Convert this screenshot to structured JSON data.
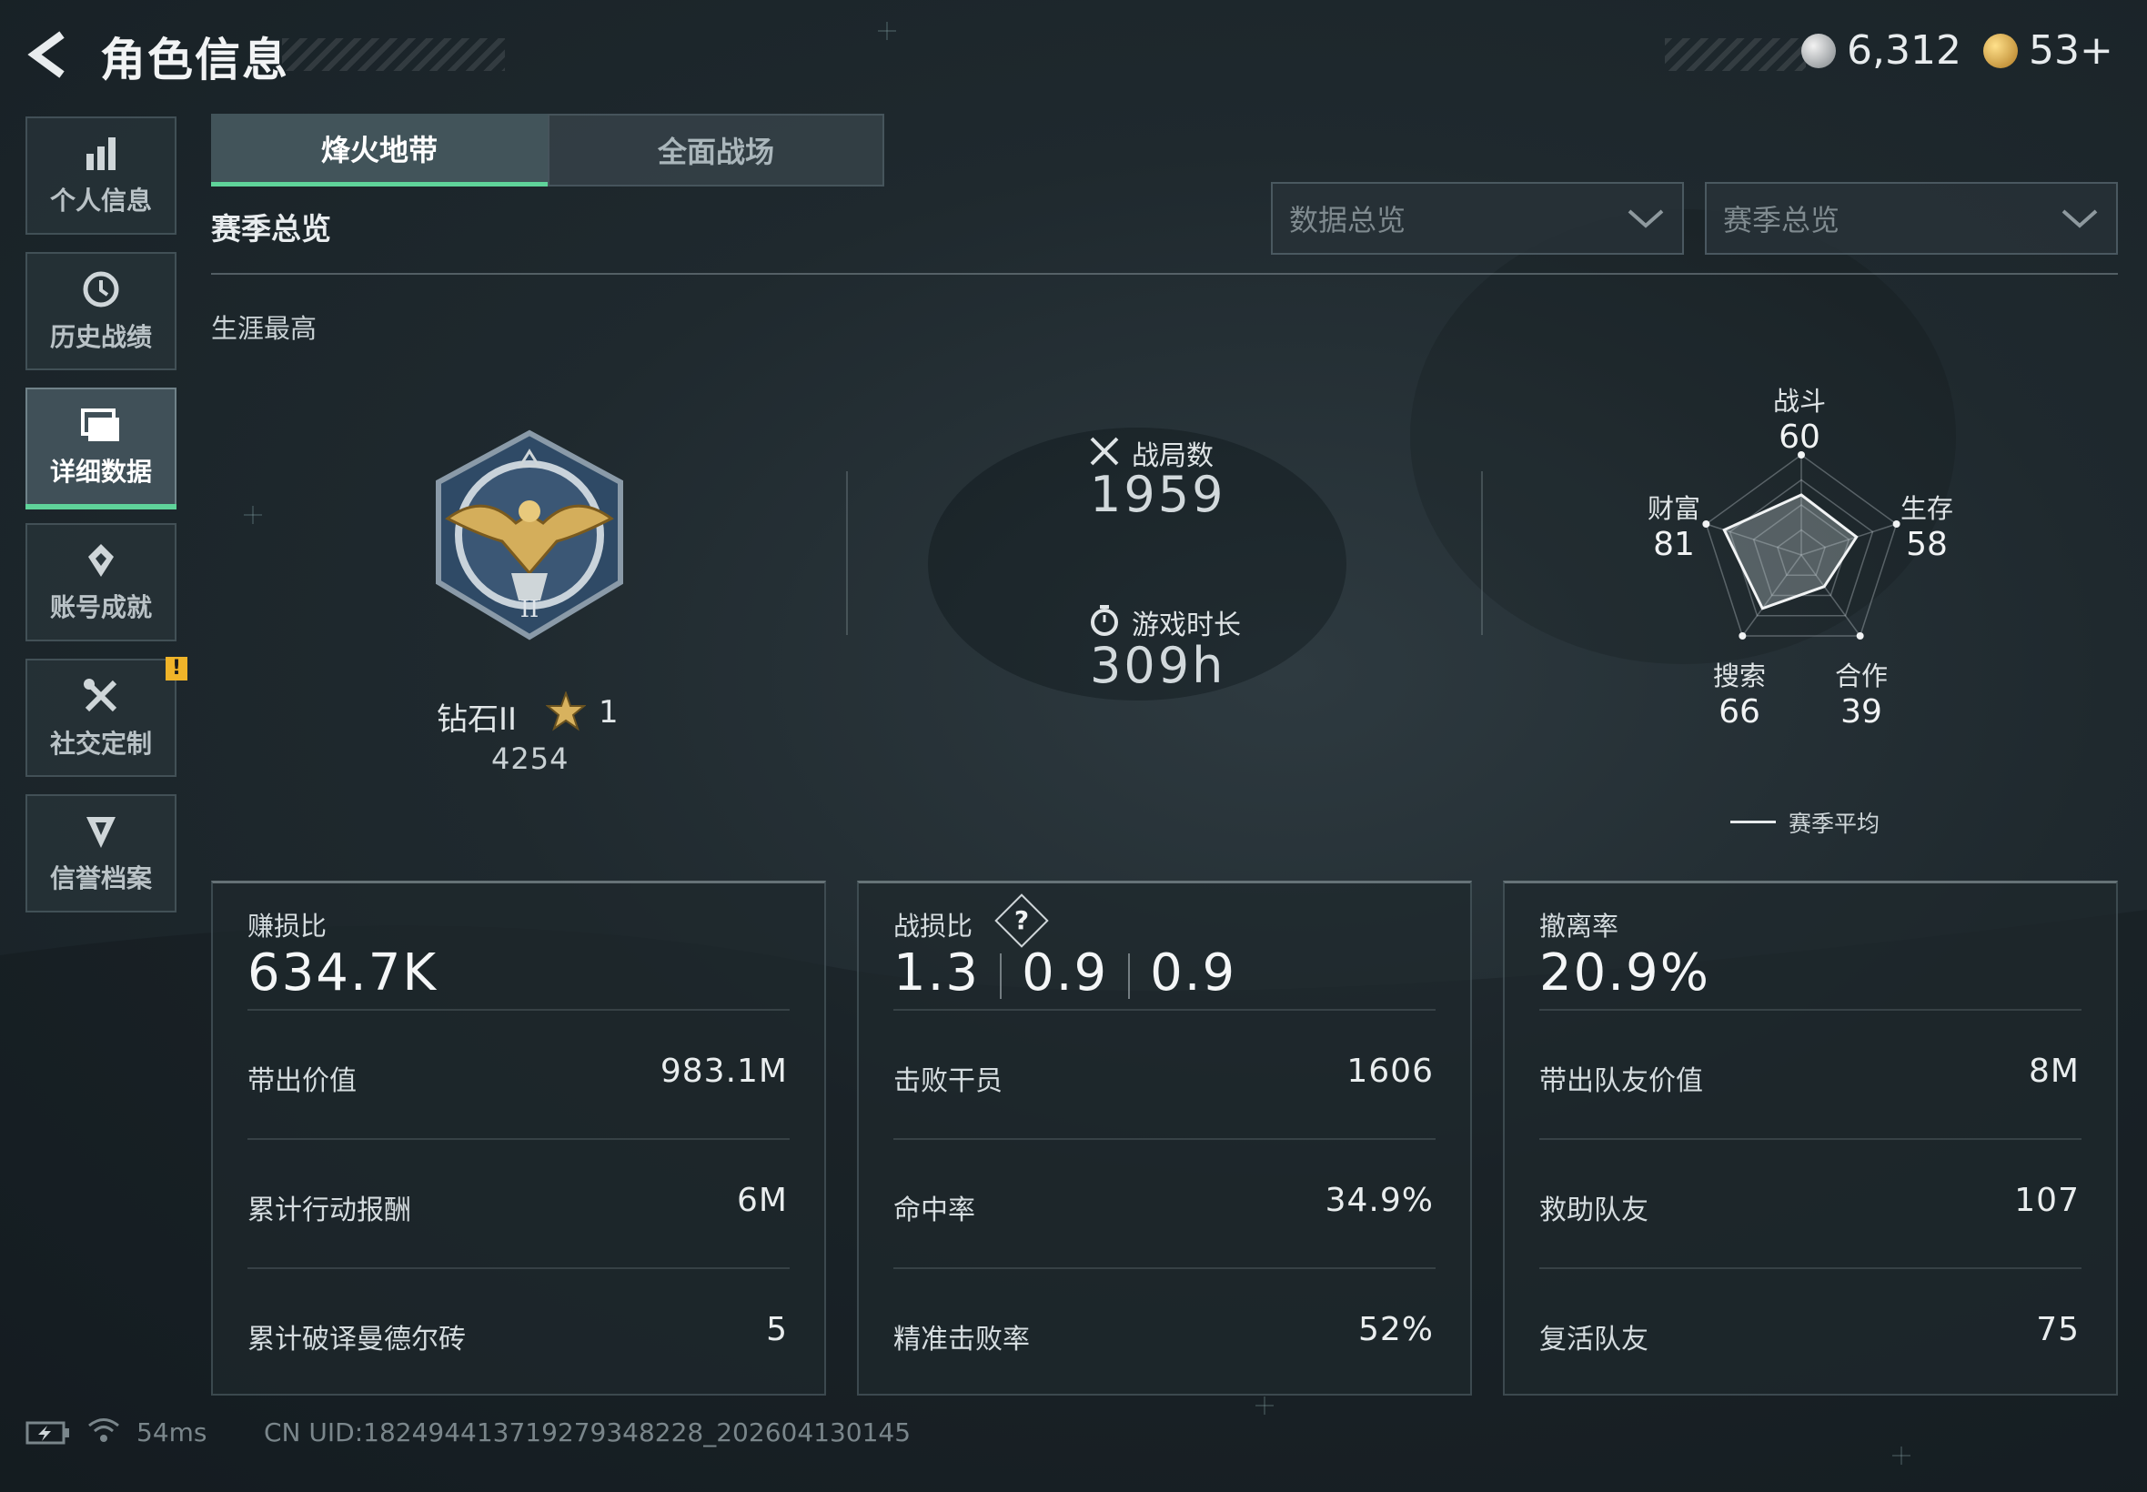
{
  "header": {
    "title": "角色信息",
    "currency_silver": "6,312",
    "currency_gold": "53+"
  },
  "sidebar": {
    "items": [
      {
        "label": "个人信息",
        "icon": "bar-chart-icon"
      },
      {
        "label": "历史战绩",
        "icon": "clock-history-icon"
      },
      {
        "label": "详细数据",
        "icon": "folder-icon",
        "active": true
      },
      {
        "label": "账号成就",
        "icon": "achievement-icon"
      },
      {
        "label": "社交定制",
        "icon": "tools-icon",
        "badge": "!"
      },
      {
        "label": "信誉档案",
        "icon": "shield-icon"
      }
    ]
  },
  "tabs": [
    {
      "label": "烽火地带",
      "active": true
    },
    {
      "label": "全面战场",
      "active": false
    }
  ],
  "section": {
    "title": "赛季总览",
    "subtitle": "生涯最高"
  },
  "filters": {
    "data_select": "数据总览",
    "season_select": "赛季总览"
  },
  "rank": {
    "name": "钻石II",
    "stars": "1",
    "score": "4254",
    "emblem_text": "II"
  },
  "stats": {
    "matches_label": "战局数",
    "matches_value": "1959",
    "playtime_label": "游戏时长",
    "playtime_value": "309h"
  },
  "radar": {
    "axes": [
      {
        "label": "战斗",
        "value": 60
      },
      {
        "label": "生存",
        "value": 58
      },
      {
        "label": "合作",
        "value": 39
      },
      {
        "label": "搜索",
        "value": 66
      },
      {
        "label": "财富",
        "value": 81
      }
    ],
    "legend": "赛季平均"
  },
  "cards": [
    {
      "label": "赚损比",
      "big": "634.7K",
      "rows": [
        {
          "label": "带出价值",
          "value": "983.1M"
        },
        {
          "label": "累计行动报酬",
          "value": "6M"
        },
        {
          "label": "累计破译曼德尔砖",
          "value": "5"
        }
      ]
    },
    {
      "label": "战损比",
      "big_parts": [
        "1.3",
        "0.9",
        "0.9"
      ],
      "help": "?",
      "rows": [
        {
          "label": "击败干员",
          "value": "1606"
        },
        {
          "label": "命中率",
          "value": "34.9%"
        },
        {
          "label": "精准击败率",
          "value": "52%"
        }
      ]
    },
    {
      "label": "撤离率",
      "big": "20.9%",
      "rows": [
        {
          "label": "带出队友价值",
          "value": "8M"
        },
        {
          "label": "救助队友",
          "value": "107"
        },
        {
          "label": "复活队友",
          "value": "75"
        }
      ]
    }
  ],
  "footer": {
    "ping": "54ms",
    "uid": "CN UID:182494413719279348228_202604130145"
  },
  "colors": {
    "accent_green": "#5fd39a",
    "warning_yellow": "#f0b429"
  }
}
